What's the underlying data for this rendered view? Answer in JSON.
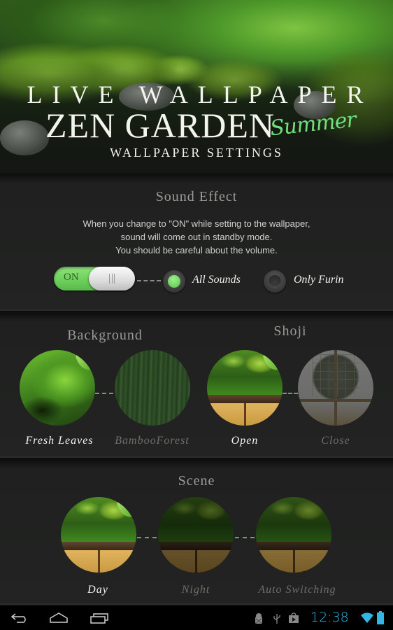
{
  "header": {
    "line1": "LIVE WALLPAPER",
    "line2": "ZEN GARDEN",
    "script_word": "Summer",
    "subtitle": "WALLPAPER SETTINGS"
  },
  "sound_effect": {
    "title": "Sound Effect",
    "description": [
      "When you change to \"ON\" while setting to the wallpaper,",
      "sound will come out in standby mode.",
      "You should be careful about the volume."
    ],
    "toggle": {
      "label": "ON",
      "state": "on",
      "color": "#6fd05d"
    },
    "options": [
      {
        "label": "All Sounds",
        "selected": true
      },
      {
        "label": "Only Furin",
        "selected": false
      }
    ]
  },
  "background": {
    "title": "Background",
    "options": [
      {
        "label": "Fresh Leaves",
        "selected": true
      },
      {
        "label": "BambooForest",
        "selected": false
      }
    ]
  },
  "shoji": {
    "title": "Shoji",
    "options": [
      {
        "label": "Open",
        "selected": true
      },
      {
        "label": "Close",
        "selected": false
      }
    ]
  },
  "scene": {
    "title": "Scene",
    "options": [
      {
        "label": "Day",
        "selected": true
      },
      {
        "label": "Night",
        "selected": false
      },
      {
        "label": "Auto Switching",
        "selected": false
      }
    ]
  },
  "navbar": {
    "buttons": [
      "back-icon",
      "home-icon",
      "recent-apps-icon"
    ],
    "status_icons": [
      "android-debug-icon",
      "usb-icon",
      "play-store-icon",
      "wifi-icon",
      "battery-icon"
    ],
    "clock": "12:38",
    "accent_color": "#33b5e5"
  }
}
